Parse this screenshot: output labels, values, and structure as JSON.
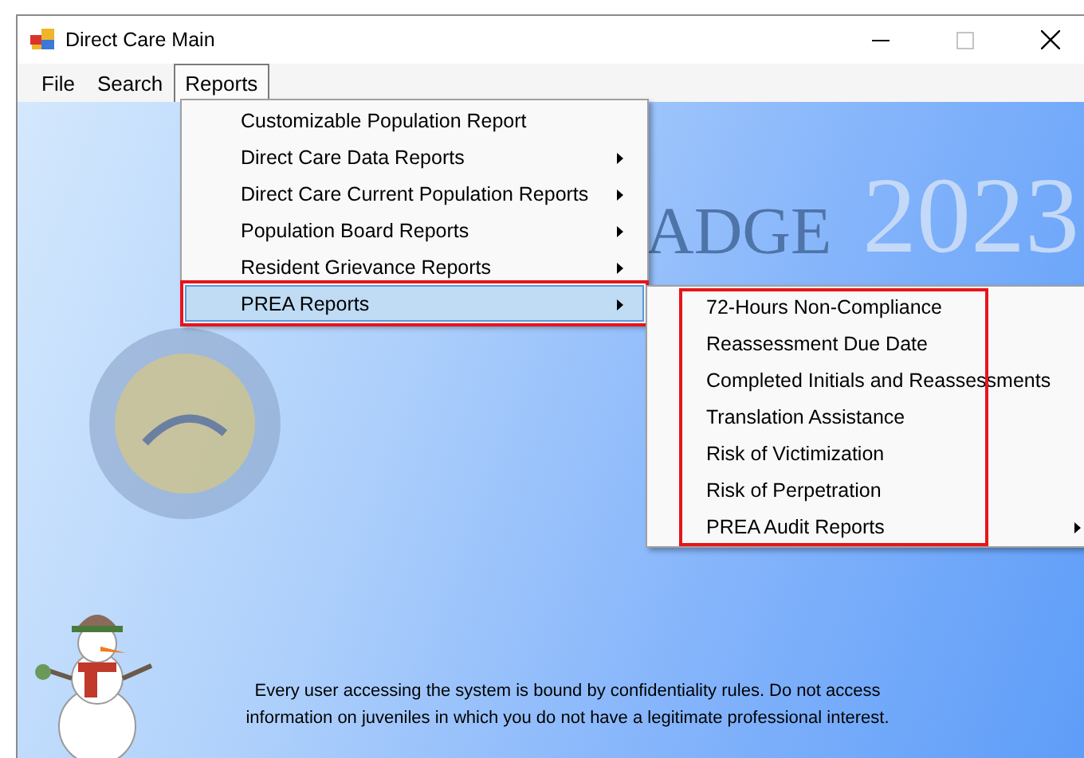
{
  "window": {
    "title": "Direct Care Main"
  },
  "menu_bar": [
    {
      "label": "File",
      "selected": false
    },
    {
      "label": "Search",
      "selected": false
    },
    {
      "label": "Reports",
      "selected": true
    }
  ],
  "reports_menu": [
    {
      "label": "Customizable Population Report",
      "submenu": false,
      "selected": false,
      "annotated": false
    },
    {
      "label": "Direct Care Data Reports",
      "submenu": true,
      "selected": false,
      "annotated": false
    },
    {
      "label": "Direct Care Current Population Reports",
      "submenu": true,
      "selected": false,
      "annotated": false
    },
    {
      "label": "Population Board Reports",
      "submenu": true,
      "selected": false,
      "annotated": false
    },
    {
      "label": "Resident Grievance Reports",
      "submenu": true,
      "selected": false,
      "annotated": false
    },
    {
      "label": "PREA Reports",
      "submenu": true,
      "selected": true,
      "annotated": true
    }
  ],
  "prea_submenu": {
    "annotated": true,
    "items": [
      {
        "label": "72-Hours Non-Compliance",
        "submenu": false
      },
      {
        "label": "Reassessment Due Date",
        "submenu": false
      },
      {
        "label": "Completed Initials and Reassessments",
        "submenu": false
      },
      {
        "label": "Translation Assistance",
        "submenu": false
      },
      {
        "label": "Risk of Victimization",
        "submenu": false
      },
      {
        "label": "Risk of Perpetration",
        "submenu": false
      },
      {
        "label": "PREA Audit Reports",
        "submenu": true
      }
    ]
  },
  "background": {
    "banner_text": "ADGE",
    "year": "2023"
  },
  "notice": "Every user accessing the system is bound by confidentiality rules. Do not access information on juveniles in which you do not have a legitimate professional interest."
}
